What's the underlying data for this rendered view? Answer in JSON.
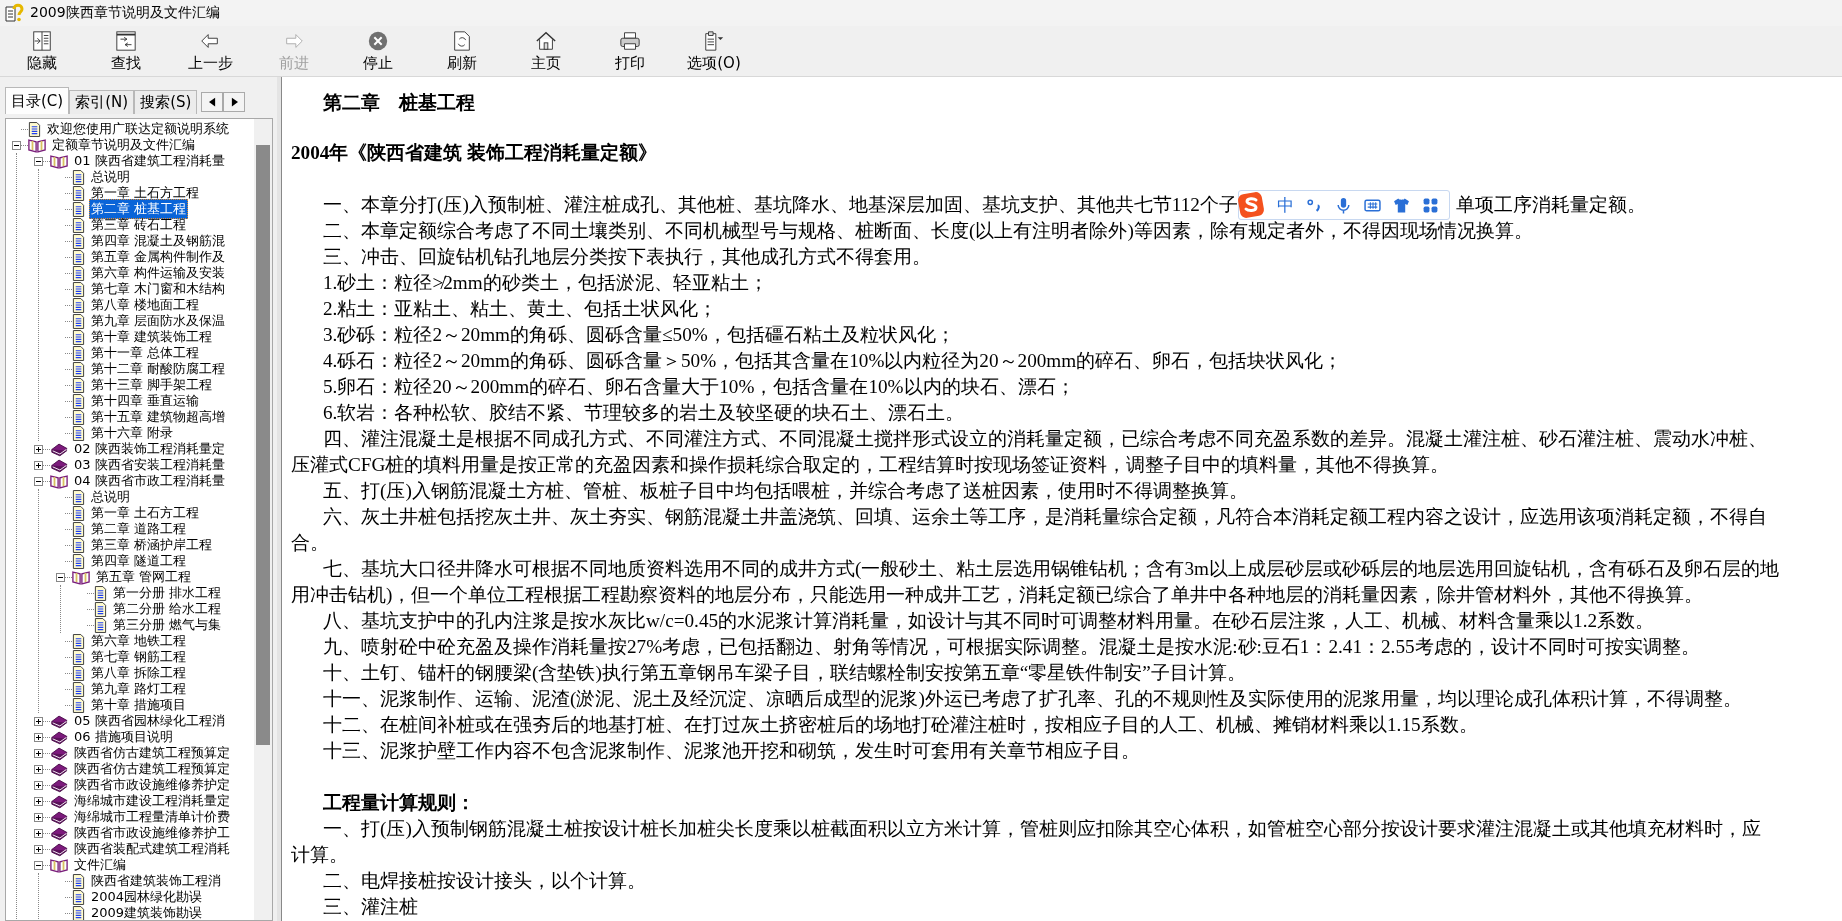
{
  "window": {
    "title": "2009陕西章节说明及文件汇编"
  },
  "toolbar": [
    {
      "kind": "hide",
      "label": "隐藏",
      "disabled": false
    },
    {
      "kind": "find",
      "label": "查找",
      "disabled": false
    },
    {
      "kind": "back",
      "label": "上一步",
      "disabled": false
    },
    {
      "kind": "forward",
      "label": "前进",
      "disabled": true
    },
    {
      "kind": "stop",
      "label": "停止",
      "disabled": false
    },
    {
      "kind": "refresh",
      "label": "刷新",
      "disabled": false
    },
    {
      "kind": "home",
      "label": "主页",
      "disabled": false
    },
    {
      "kind": "print",
      "label": "打印",
      "disabled": false
    },
    {
      "kind": "options",
      "label": "选项(O)",
      "disabled": false
    }
  ],
  "tabs": [
    {
      "label": "目录(C)",
      "selected": true
    },
    {
      "label": "索引(N)",
      "selected": false
    },
    {
      "label": "搜索(S)",
      "selected": false
    }
  ],
  "tree": {
    "items": [
      {
        "kind": "page",
        "label": "欢迎您使用广联达定额说明系统",
        "selected": false
      },
      {
        "kind": "book",
        "label": "定额章节说明及文件汇编",
        "selected": false,
        "expanded": true,
        "children": [
          {
            "kind": "book",
            "label": "01  陕西省建筑工程消耗量",
            "selected": false,
            "expanded": true,
            "children": [
              {
                "kind": "page",
                "label": "总说明",
                "selected": false
              },
              {
                "kind": "page",
                "label": "第一章  土石方工程",
                "selected": false
              },
              {
                "kind": "page",
                "label": "第二章  桩基工程",
                "selected": true
              },
              {
                "kind": "page",
                "label": "第三章  砖石工程",
                "selected": false
              },
              {
                "kind": "page",
                "label": "第四章  混凝土及钢筋混",
                "selected": false
              },
              {
                "kind": "page",
                "label": "第五章  金属构件制作及",
                "selected": false
              },
              {
                "kind": "page",
                "label": "第六章  构件运输及安装",
                "selected": false
              },
              {
                "kind": "page",
                "label": "第七章  木门窗和木结构",
                "selected": false
              },
              {
                "kind": "page",
                "label": "第八章  楼地面工程",
                "selected": false
              },
              {
                "kind": "page",
                "label": "第九章  层面防水及保温",
                "selected": false
              },
              {
                "kind": "page",
                "label": "第十章  建筑装饰工程",
                "selected": false
              },
              {
                "kind": "page",
                "label": "第十一章  总体工程",
                "selected": false
              },
              {
                "kind": "page",
                "label": "第十二章  耐酸防腐工程",
                "selected": false
              },
              {
                "kind": "page",
                "label": "第十三章  脚手架工程",
                "selected": false
              },
              {
                "kind": "page",
                "label": "第十四章  垂直运输",
                "selected": false
              },
              {
                "kind": "page",
                "label": "第十五章  建筑物超高增",
                "selected": false
              },
              {
                "kind": "page",
                "label": "第十六章  附录",
                "selected": false
              }
            ]
          },
          {
            "kind": "book",
            "label": "02  陕西装饰工程消耗量定",
            "selected": false,
            "expanded": false
          },
          {
            "kind": "book",
            "label": "03  陕西省安装工程消耗量",
            "selected": false,
            "expanded": false
          },
          {
            "kind": "book",
            "label": "04  陕西省市政工程消耗量",
            "selected": false,
            "expanded": true,
            "children": [
              {
                "kind": "page",
                "label": "总说明",
                "selected": false
              },
              {
                "kind": "page",
                "label": "第一章  土石方工程",
                "selected": false
              },
              {
                "kind": "page",
                "label": "第二章  道路工程",
                "selected": false
              },
              {
                "kind": "page",
                "label": "第三章  桥涵护岸工程",
                "selected": false
              },
              {
                "kind": "page",
                "label": "第四章  隧道工程",
                "selected": false
              },
              {
                "kind": "book",
                "label": "第五章  管网工程",
                "selected": false,
                "expanded": true,
                "children": [
                  {
                    "kind": "page",
                    "label": "第一分册  排水工程",
                    "selected": false
                  },
                  {
                    "kind": "page",
                    "label": "第二分册  给水工程",
                    "selected": false
                  },
                  {
                    "kind": "page",
                    "label": "第三分册  燃气与集",
                    "selected": false
                  }
                ]
              },
              {
                "kind": "page",
                "label": "第六章  地铁工程",
                "selected": false
              },
              {
                "kind": "page",
                "label": "第七章  钢筋工程",
                "selected": false
              },
              {
                "kind": "page",
                "label": "第八章  拆除工程",
                "selected": false
              },
              {
                "kind": "page",
                "label": "第九章  路灯工程",
                "selected": false
              },
              {
                "kind": "page",
                "label": "第十章  措施项目",
                "selected": false
              }
            ]
          },
          {
            "kind": "book",
            "label": "05  陕西省园林绿化工程消",
            "selected": false,
            "expanded": false
          },
          {
            "kind": "book",
            "label": "06  措施项目说明",
            "selected": false,
            "expanded": false
          },
          {
            "kind": "book",
            "label": "陕西省仿古建筑工程预算定",
            "selected": false,
            "expanded": false
          },
          {
            "kind": "book",
            "label": "陕西省仿古建筑工程预算定",
            "selected": false,
            "expanded": false
          },
          {
            "kind": "book",
            "label": "陕西省市政设施维修养护定",
            "selected": false,
            "expanded": false
          },
          {
            "kind": "book",
            "label": "海绵城市建设工程消耗量定",
            "selected": false,
            "expanded": false
          },
          {
            "kind": "book",
            "label": "海绵城市工程量清单计价费",
            "selected": false,
            "expanded": false
          },
          {
            "kind": "book",
            "label": "陕西省市政设施维修养护工",
            "selected": false,
            "expanded": false
          },
          {
            "kind": "book",
            "label": "陕西省装配式建筑工程消耗",
            "selected": false,
            "expanded": false
          },
          {
            "kind": "book",
            "label": "文件汇编",
            "selected": false,
            "expanded": true,
            "children": [
              {
                "kind": "page",
                "label": "陕西省建筑装饰工程消",
                "selected": false
              },
              {
                "kind": "page",
                "label": "2004园林绿化勘误",
                "selected": false
              },
              {
                "kind": "page",
                "label": "2009建筑装饰勘误",
                "selected": false
              }
            ]
          }
        ]
      }
    ]
  },
  "content": {
    "chapter_title": "第二章　桩基工程",
    "book_title": "2004年《陕西省建筑 装饰工程消耗量定额》",
    "ime_toolbar": {
      "mode": "中"
    },
    "paragraphs": [
      {
        "lines": [
          [
            "一、本章分打(压)入预制桩、灌注桩成孔、其他桩、基坑降水、地基深层加固、基坑支护、其他共七节112个子",
            "单项工序消耗量定额。"
          ]
        ]
      },
      {
        "lines": [
          [
            "二、本章定额综合考虑了不同土壤类别、不同机械型号与规格、桩断面、长度(以上有注明者除外)等因素，除有规定者外，不得因现场情况换算。"
          ]
        ]
      },
      {
        "lines": [
          [
            "三、冲击、回旋钻机钻孔地层分类按下表执行，其他成孔方式不得套用。"
          ]
        ]
      },
      {
        "lines": [
          [
            "1.砂土：粒径≯2mm的砂类土，包括淤泥、轻亚粘土；"
          ]
        ]
      },
      {
        "lines": [
          [
            "2.粘土：亚粘土、粘土、黄土、包括土状风化；"
          ]
        ]
      },
      {
        "lines": [
          [
            "3.砂砾：粒径2～20mm的角砾、圆砾含量≤50%，包括礓石粘土及粒状风化；"
          ]
        ]
      },
      {
        "lines": [
          [
            "4.砾石：粒径2～20mm的角砾、圆砾含量＞50%，包括其含量在10%以内粒径为20～200mm的碎石、卵石，包括块状风化；"
          ]
        ]
      },
      {
        "lines": [
          [
            "5.卵石：粒径20～200mm的碎石、卵石含量大于10%，包括含量在10%以内的块石、漂石；"
          ]
        ]
      },
      {
        "lines": [
          [
            "6.软岩：各种松软、胶结不紧、节理较多的岩土及较坚硬的块石土、漂石土。"
          ]
        ]
      },
      {
        "lines": [
          [
            "四、灌注混凝土是根据不同成孔方式、不同灌注方式、不同混凝土搅拌形式设立的消耗量定额，已综合考虑不同充盈系数的差异。混凝土灌注桩、砂石灌注桩、震动水冲桩、"
          ],
          [
            "压灌式CFG桩的填料用量是按正常的充盈因素和操作损耗综合取定的，工程结算时按现场签证资料，调整子目中的填料量，其他不得换算。"
          ]
        ]
      },
      {
        "lines": [
          [
            "五、打(压)入钢筋混凝土方桩、管桩、板桩子目中均包括喂桩，并综合考虑了送桩因素，使用时不得调整换算。"
          ]
        ]
      },
      {
        "lines": [
          [
            "六、灰土井桩包括挖灰土井、灰土夯实、钢筋混凝土井盖浇筑、回填、运余土等工序，是消耗量综合定额，凡符合本消耗定额工程内容之设计，应选用该项消耗定额，不得自"
          ],
          [
            "合。"
          ]
        ]
      },
      {
        "lines": [
          [
            "七、基坑大口径井降水可根据不同地质资料选用不同的成井方式(一般砂土、粘土层选用锅锥钻机；含有3m以上成层砂层或砂砾层的地层选用回旋钻机，含有砾石及卵石层的地"
          ],
          [
            "用冲击钻机)，但一个单位工程根据工程勘察资料的地层分布，只能选用一种成井工艺，消耗定额已综合了单井中各种地层的消耗量因素，除井管材料外，其他不得换算。"
          ]
        ]
      },
      {
        "lines": [
          [
            "八、基坑支护中的孔内注浆是按水灰比w/c=0.45的水泥浆计算消耗量，如设计与其不同时可调整材料用量。在砂石层注浆，人工、机械、材料含量乘以1.2系数。"
          ]
        ]
      },
      {
        "lines": [
          [
            "九、喷射砼中砼充盈及操作消耗量按27%考虑，已包括翻边、射角等情况，可根据实际调整。混凝土是按水泥:砂:豆石1：2.41：2.55考虑的，设计不同时可按实调整。"
          ]
        ]
      },
      {
        "lines": [
          [
            "十、土钉、锚杆的钢腰梁(含垫铁)执行第五章钢吊车梁子目，联结螺栓制安按第五章“零星铁件制安”子目计算。"
          ]
        ]
      },
      {
        "lines": [
          [
            "十一、泥浆制作、运输、泥渣(淤泥、泥土及经沉淀、凉晒后成型的泥浆)外运已考虑了扩孔率、孔的不规则性及实际使用的泥浆用量，均以理论成孔体积计算，不得调整。"
          ]
        ]
      },
      {
        "lines": [
          [
            "十二、在桩间补桩或在强夯后的地基打桩、在打过灰土挤密桩后的场地打砼灌注桩时，按相应子目的人工、机械、摊销材料乘以1.15系数。"
          ]
        ]
      },
      {
        "lines": [
          [
            "十三、泥浆护壁工作内容不包含泥浆制作、泥浆池开挖和砌筑，发生时可套用有关章节相应子目。"
          ]
        ]
      }
    ],
    "rules_heading": "工程量计算规则：",
    "rules": [
      {
        "lines": [
          [
            "一、打(压)入预制钢筋混凝土桩按设计桩长加桩尖长度乘以桩截面积以立方米计算，管桩则应扣除其空心体积，如管桩空心部分按设计要求灌注混凝土或其他填充材料时，应"
          ],
          [
            "计算。"
          ]
        ]
      },
      {
        "lines": [
          [
            "二、电焊接桩按设计接头，以个计算。"
          ]
        ]
      },
      {
        "lines": [
          [
            "三、灌注桩"
          ]
        ]
      }
    ]
  }
}
